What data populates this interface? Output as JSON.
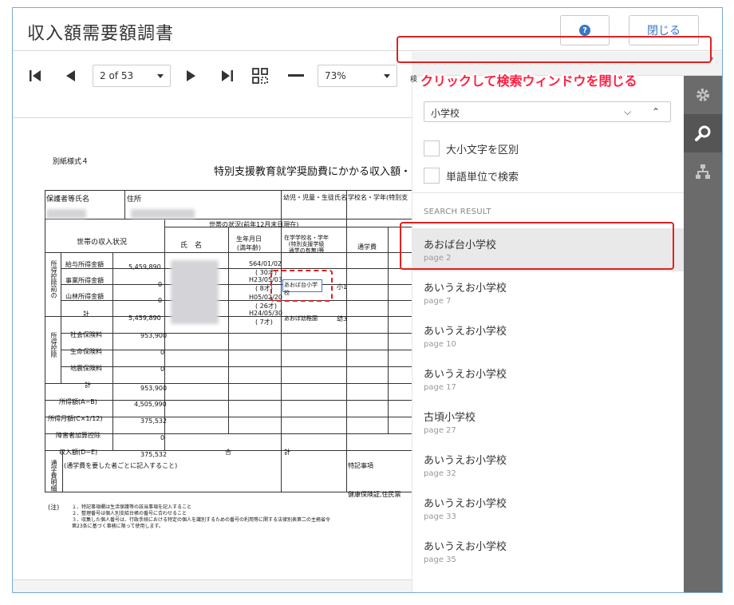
{
  "app": {
    "title": "収入額需要額調書",
    "help_label": "?",
    "close_label": "閉じる"
  },
  "toolbar": {
    "page_indicator": "2 of 53",
    "zoom": "73%"
  },
  "callout": {
    "text": "クリックして検索ウィンドウを閉じる",
    "partial_label": "検"
  },
  "search": {
    "query": "小学校",
    "case_sensitive_label": "大小文字を区別",
    "whole_word_label": "単語単位で検索",
    "results_header": "SEARCH RESULT",
    "results": [
      {
        "name": "あおば台小学校",
        "page": "page 2"
      },
      {
        "name": "あいうえお小学校",
        "page": "page 7"
      },
      {
        "name": "あいうえお小学校",
        "page": "page 10"
      },
      {
        "name": "あいうえお小学校",
        "page": "page 17"
      },
      {
        "name": "古頃小学校",
        "page": "page 27"
      },
      {
        "name": "あいうえお小学校",
        "page": "page 32"
      },
      {
        "name": "あいうえお小学校",
        "page": "page 33"
      },
      {
        "name": "あいうえお小学校",
        "page": "page 35"
      }
    ]
  },
  "document": {
    "form_label": "別紙様式４",
    "form_title": "特別支援教育就学奨励費にかかる収入額・需",
    "header_cells": [
      "保護者等氏名",
      "住所",
      "幼児・児童・生徒氏名",
      "学校名・学年(特別支"
    ],
    "income_label": "世帯の収入状況",
    "household_label": "世帯の状況(前年12月末日現在)",
    "col_name": "氏　名",
    "col_birth": "生年月日\n(満年齢)",
    "col_school": "在学学校名・学年\n(特別支援学級\n通学の有無)等",
    "col_commute": "通学費",
    "income_rows": [
      {
        "label": "給与所得金額",
        "value": "5,459,890"
      },
      {
        "label": "事業所得金額",
        "value": "0"
      },
      {
        "label": "山林所得金額",
        "value": "0"
      },
      {
        "label": "計",
        "value": "5,459,890"
      }
    ],
    "deduction_rows": [
      {
        "label": "社会保険料",
        "value": "953,900"
      },
      {
        "label": "生命保険料",
        "value": "0"
      },
      {
        "label": "地震保険料",
        "value": "0"
      },
      {
        "label": "計",
        "value": "953,900"
      }
    ],
    "summary_rows": [
      {
        "label": "所得額(A−B)",
        "value": "4,505,990"
      },
      {
        "label": "所得月額(C×1/12)",
        "value": "375,532"
      },
      {
        "label": "障害者加算控除",
        "value": "0"
      },
      {
        "label": "収入額(D−E)",
        "value": "375,532"
      }
    ],
    "births": [
      "S64/01/02",
      "( 30才)",
      "H23/05/03",
      "( 8才)",
      "H05/02/20",
      "( 26才)",
      "H24/05/30",
      "( 7才)"
    ],
    "school_highlight": "あおば台小学校",
    "school_other": "あおば幼稚園",
    "grade_1": "小1",
    "grade_2": "幼3",
    "total_label": "合",
    "total_label2": "計",
    "commute_note": "(通学費を要した者ごとに記入すること)",
    "special_note": "特記事項",
    "insurance_note": "健康保険証,住民票",
    "vertical_before": "所得控除前の",
    "vertical_deduct": "所得控除",
    "vertical_commute": "通学費明細",
    "notes_label": "(注)",
    "notes": [
      "１．特記事項欄は生活保護等の該当事項を記入すること",
      "２．整理番号は個人別支給台帳の番号に合わせること",
      "３．収集した個人番号は、行政手続における特定の個人を識別するための番号の利用等に関する法律別表第二の主務省令",
      "第23条に基づく事務に限って使用します。"
    ]
  }
}
